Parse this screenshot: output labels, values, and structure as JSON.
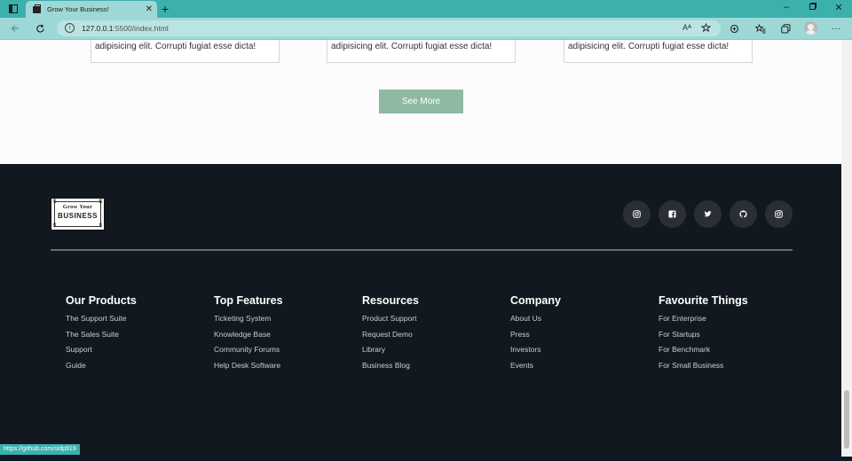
{
  "browser": {
    "tab_title": "Grow Your Business!",
    "tab_close": "✕",
    "new_tab": "+",
    "url_host": "127.0.0.1",
    "url_rest": ":5500/index.html",
    "read_aloud": "Aᴬ",
    "info_icon": "i"
  },
  "cards": {
    "text": "adipisicing elit. Corrupti fugiat esse dicta!"
  },
  "see_more": {
    "label": "See More"
  },
  "footer": {
    "logo_line1": "Grow Your",
    "logo_line2": "BUSINESS",
    "logo_dollar": "$",
    "columns": [
      {
        "title": "Our Products",
        "items": [
          "The Support Suite",
          "The Sales Suite",
          "Support",
          "Guide"
        ]
      },
      {
        "title": "Top Features",
        "items": [
          "Ticketing System",
          "Knowledge Base",
          "Community Forums",
          "Help Desk Software"
        ]
      },
      {
        "title": "Resources",
        "items": [
          "Product Support",
          "Request Demo",
          "Library",
          "Business Blog"
        ]
      },
      {
        "title": "Company",
        "items": [
          "About Us",
          "Press",
          "Investors",
          "Events"
        ]
      },
      {
        "title": "Favourite Things",
        "items": [
          "For Enterprise",
          "For Startups",
          "For Benchmark",
          "For Small Business"
        ]
      }
    ],
    "social_icons": [
      "instagram-icon",
      "facebook-icon",
      "twitter-icon",
      "github-icon",
      "instagram-icon"
    ]
  },
  "status_url": "https://github.com/sidp919",
  "colors": {
    "chrome": "#3bb0ad",
    "footer_bg": "#11181f",
    "button": "#8fb9a3"
  }
}
